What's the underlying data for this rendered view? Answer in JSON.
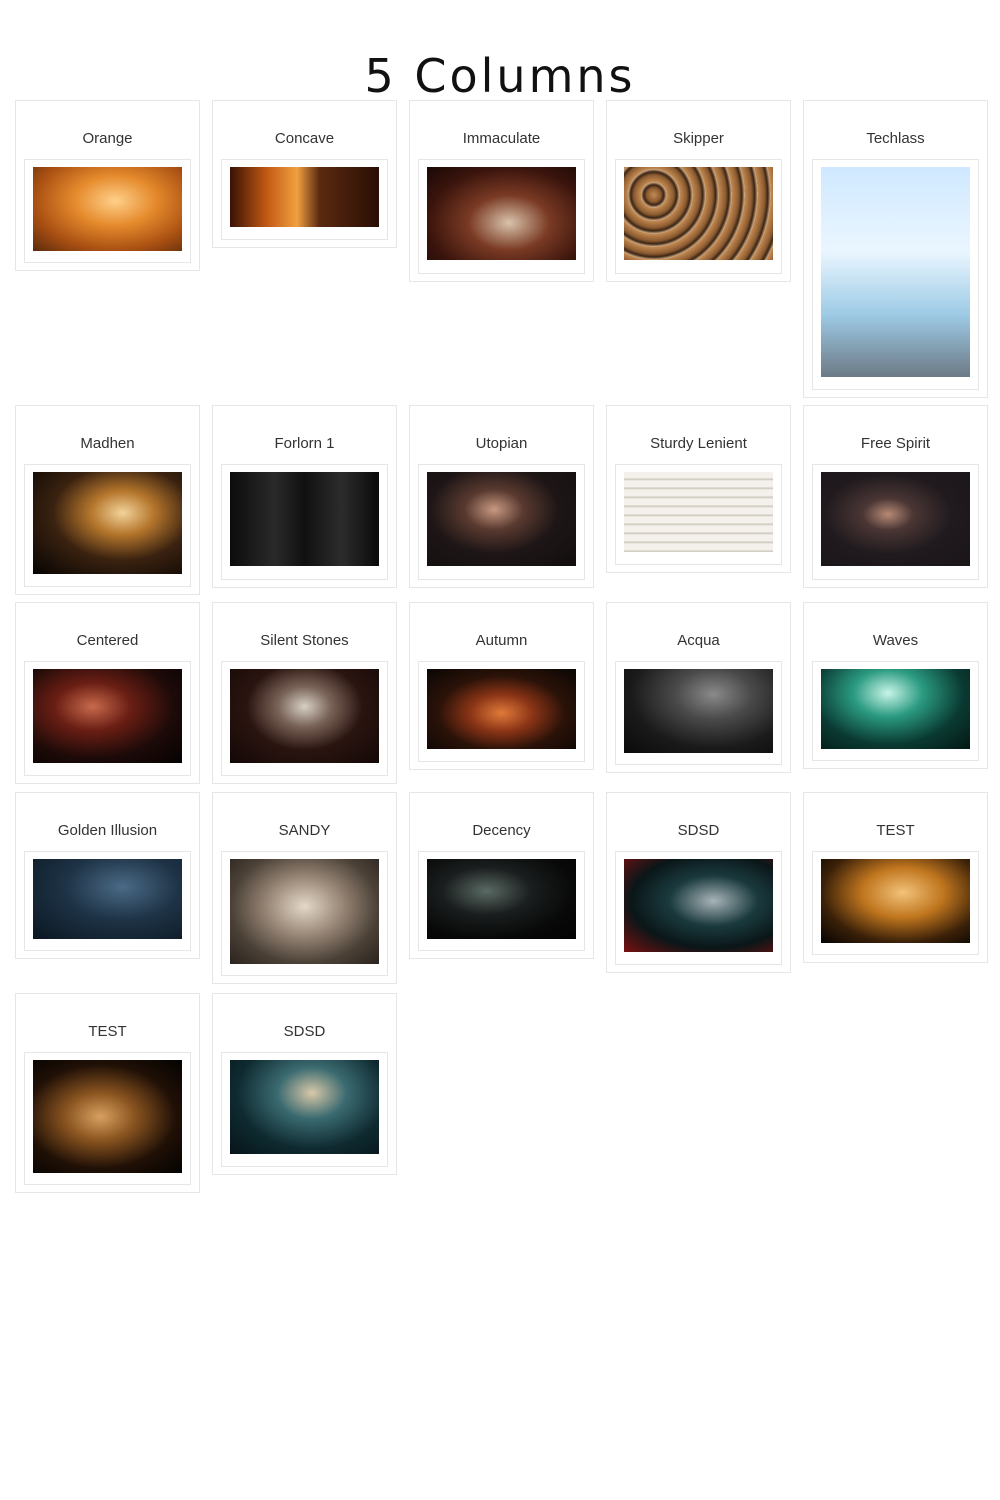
{
  "page": {
    "title": "5 Columns"
  },
  "gallery": {
    "items": [
      {
        "label": "Orange"
      },
      {
        "label": "Concave"
      },
      {
        "label": "Immaculate"
      },
      {
        "label": "Skipper"
      },
      {
        "label": "Techlass"
      },
      {
        "label": "Madhen"
      },
      {
        "label": "Forlorn 1"
      },
      {
        "label": "Utopian"
      },
      {
        "label": "Sturdy Lenient"
      },
      {
        "label": "Free Spirit"
      },
      {
        "label": "Centered"
      },
      {
        "label": "Silent Stones"
      },
      {
        "label": "Autumn"
      },
      {
        "label": "Acqua"
      },
      {
        "label": "Waves"
      },
      {
        "label": "Golden Illusion"
      },
      {
        "label": "SANDY"
      },
      {
        "label": "Decency"
      },
      {
        "label": "SDSD"
      },
      {
        "label": "TEST"
      },
      {
        "label": "TEST"
      },
      {
        "label": "SDSD"
      }
    ]
  }
}
